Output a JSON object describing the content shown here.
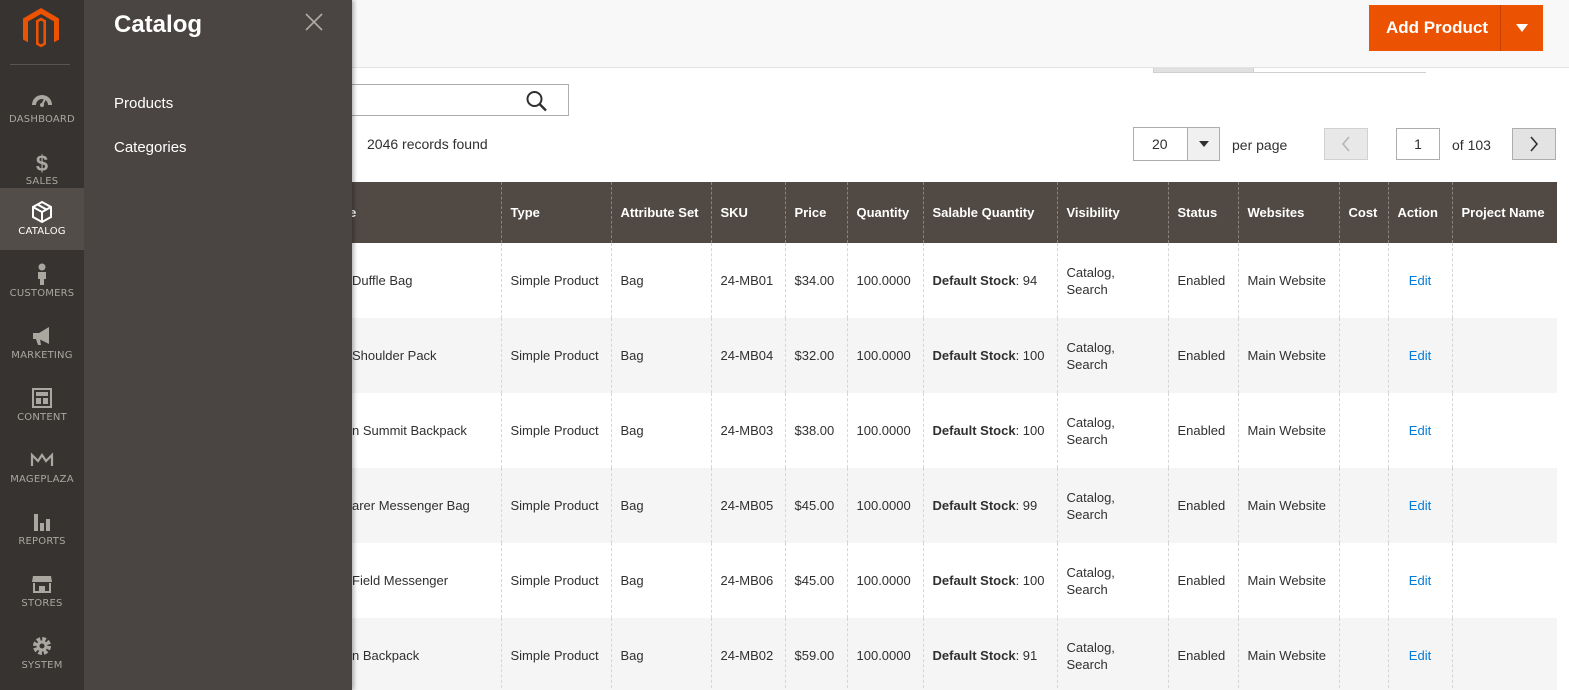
{
  "nav": {
    "items": [
      {
        "label": "DASHBOARD",
        "icon": "dashboard-icon"
      },
      {
        "label": "SALES",
        "icon": "dollar-icon"
      },
      {
        "label": "CATALOG",
        "icon": "box-icon",
        "active": true
      },
      {
        "label": "CUSTOMERS",
        "icon": "person-icon"
      },
      {
        "label": "MARKETING",
        "icon": "megaphone-icon"
      },
      {
        "label": "CONTENT",
        "icon": "layout-icon"
      },
      {
        "label": "MAGEPLAZA",
        "icon": "mageplaza-logo-icon"
      },
      {
        "label": "REPORTS",
        "icon": "bar-chart-icon"
      },
      {
        "label": "STORES",
        "icon": "store-icon"
      },
      {
        "label": "SYSTEM",
        "icon": "gear-icon"
      }
    ],
    "accent_color": "#eb5202"
  },
  "catalog_panel": {
    "title": "Catalog",
    "links": [
      "Products",
      "Categories"
    ]
  },
  "header": {
    "add_product_label": "Add Product"
  },
  "grid": {
    "records_found": "2046 records found",
    "per_page_value": "20",
    "per_page_label": "per page",
    "current_page": "1",
    "page_of": "of 103",
    "columns": [
      "e",
      "Type",
      "Attribute Set",
      "SKU",
      "Price",
      "Quantity",
      "Salable Quantity",
      "Visibility",
      "Status",
      "Websites",
      "Cost",
      "Action",
      "Project Name"
    ],
    "rows": [
      {
        "name": "Duffle Bag",
        "type": "Simple Product",
        "attribute_set": "Bag",
        "sku": "24-MB01",
        "price": "$34.00",
        "quantity": "100.0000",
        "stock_label": "Default Stock",
        "stock_value": ": 94",
        "visibility": "Catalog, Search",
        "status": "Enabled",
        "websites": "Main Website",
        "cost": "",
        "action": "Edit",
        "project_name": ""
      },
      {
        "name": "Shoulder Pack",
        "type": "Simple Product",
        "attribute_set": "Bag",
        "sku": "24-MB04",
        "price": "$32.00",
        "quantity": "100.0000",
        "stock_label": "Default Stock",
        "stock_value": ": 100",
        "visibility": "Catalog, Search",
        "status": "Enabled",
        "websites": "Main Website",
        "cost": "",
        "action": "Edit",
        "project_name": ""
      },
      {
        "name": "n Summit Backpack",
        "type": "Simple Product",
        "attribute_set": "Bag",
        "sku": "24-MB03",
        "price": "$38.00",
        "quantity": "100.0000",
        "stock_label": "Default Stock",
        "stock_value": ": 100",
        "visibility": "Catalog, Search",
        "status": "Enabled",
        "websites": "Main Website",
        "cost": "",
        "action": "Edit",
        "project_name": ""
      },
      {
        "name": "arer Messenger Bag",
        "type": "Simple Product",
        "attribute_set": "Bag",
        "sku": "24-MB05",
        "price": "$45.00",
        "quantity": "100.0000",
        "stock_label": "Default Stock",
        "stock_value": ": 99",
        "visibility": "Catalog, Search",
        "status": "Enabled",
        "websites": "Main Website",
        "cost": "",
        "action": "Edit",
        "project_name": ""
      },
      {
        "name": "Field Messenger",
        "type": "Simple Product",
        "attribute_set": "Bag",
        "sku": "24-MB06",
        "price": "$45.00",
        "quantity": "100.0000",
        "stock_label": "Default Stock",
        "stock_value": ": 100",
        "visibility": "Catalog, Search",
        "status": "Enabled",
        "websites": "Main Website",
        "cost": "",
        "action": "Edit",
        "project_name": ""
      },
      {
        "name": "n Backpack",
        "type": "Simple Product",
        "attribute_set": "Bag",
        "sku": "24-MB02",
        "price": "$59.00",
        "quantity": "100.0000",
        "stock_label": "Default Stock",
        "stock_value": ": 91",
        "visibility": "Catalog, Search",
        "status": "Enabled",
        "websites": "Main Website",
        "cost": "",
        "action": "Edit",
        "project_name": ""
      }
    ]
  }
}
